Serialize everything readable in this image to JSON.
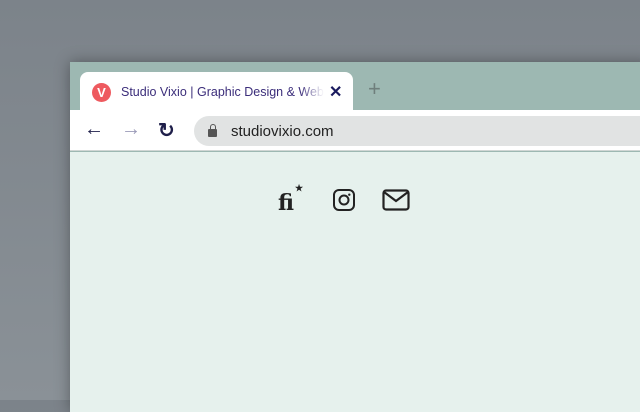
{
  "tab": {
    "favicon_letter": "V",
    "title": "Studio Vixio | Graphic Design & Web Design",
    "close": "✕",
    "new_tab": "+"
  },
  "toolbar": {
    "back": "←",
    "forward": "→",
    "reload": "↻",
    "url": "studiovixio.com"
  },
  "social": {
    "fi_logo": "fi"
  },
  "colors": {
    "tab_strip": "#9db8b2",
    "content_bg": "#e6f1ed",
    "favicon": "#ee5a5f"
  }
}
